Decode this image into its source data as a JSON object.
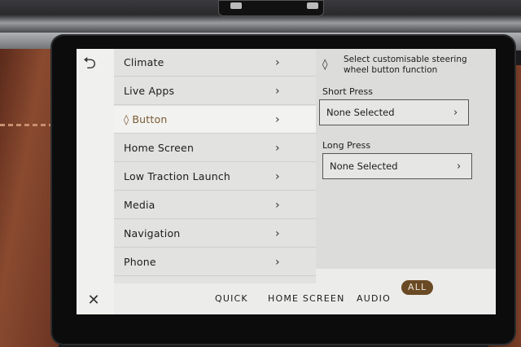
{
  "menu": {
    "items": [
      {
        "label": "Climate",
        "selected": false
      },
      {
        "label": "Live Apps",
        "selected": false
      },
      {
        "label": "Button",
        "selected": true
      },
      {
        "label": "Home Screen",
        "selected": false
      },
      {
        "label": "Low Traction Launch",
        "selected": false
      },
      {
        "label": "Media",
        "selected": false
      },
      {
        "label": "Navigation",
        "selected": false
      },
      {
        "label": "Phone",
        "selected": false
      }
    ],
    "chevron": "›",
    "selected_marker": "◊"
  },
  "panel": {
    "title": "Select customisable steering wheel button function",
    "icon": "◊",
    "short_press_label": "Short Press",
    "short_press_value": "None Selected",
    "long_press_label": "Long Press",
    "long_press_value": "None Selected"
  },
  "tabs": {
    "quick": "QUICK",
    "home_screen": "HOME SCREEN",
    "audio": "AUDIO",
    "all": "ALL",
    "active": "all"
  },
  "icons": {
    "back": "back-arrow-icon",
    "close": "close-icon",
    "scroll_up": "chevron-up-icon",
    "scroll_down": "chevron-down-icon"
  },
  "colors": {
    "accent": "#6a4a24",
    "selected_text": "#7a5a34",
    "screen_bg": "#ececea"
  }
}
